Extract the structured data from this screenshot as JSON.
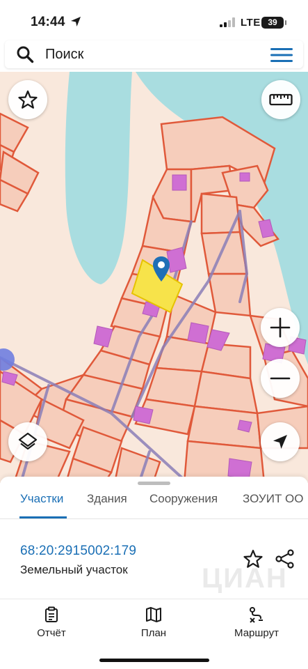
{
  "status_bar": {
    "time": "14:44",
    "network": "LTE",
    "battery": "39",
    "icons": [
      "location-arrow-icon",
      "signal-icon",
      "battery-icon"
    ]
  },
  "search": {
    "placeholder": "Поиск",
    "icon": "search-icon",
    "menu_icon": "hamburger-menu-icon"
  },
  "map": {
    "controls": {
      "favorite": "star-icon",
      "ruler": "ruler-icon",
      "zoom_in": "plus-icon",
      "zoom_out": "minus-icon",
      "layers": "layers-icon",
      "locate": "navigation-arrow-icon"
    },
    "colors": {
      "land": "#f9e8dc",
      "water": "#a9dde0",
      "parcel_fill": "#f6cdbb",
      "parcel_border": "#e0593a",
      "building": "#cf6fd3",
      "road": "#8b7fb8",
      "selected_parcel": "#f7e34a",
      "marker": "#1f6fb6"
    }
  },
  "sheet": {
    "tabs": [
      {
        "label": "Участки",
        "active": true
      },
      {
        "label": "Здания",
        "active": false
      },
      {
        "label": "Сооружения",
        "active": false
      },
      {
        "label": "ЗОУИТ ОО",
        "active": false
      }
    ],
    "parcel": {
      "number": "68:20:2915002:179",
      "type": "Земельный участок",
      "watermark": "ЦИАН"
    },
    "nav": [
      {
        "label": "Отчёт",
        "icon": "report-icon"
      },
      {
        "label": "План",
        "icon": "map-plan-icon"
      },
      {
        "label": "Маршрут",
        "icon": "route-icon"
      }
    ]
  },
  "accent_color": "#1a6fb5"
}
